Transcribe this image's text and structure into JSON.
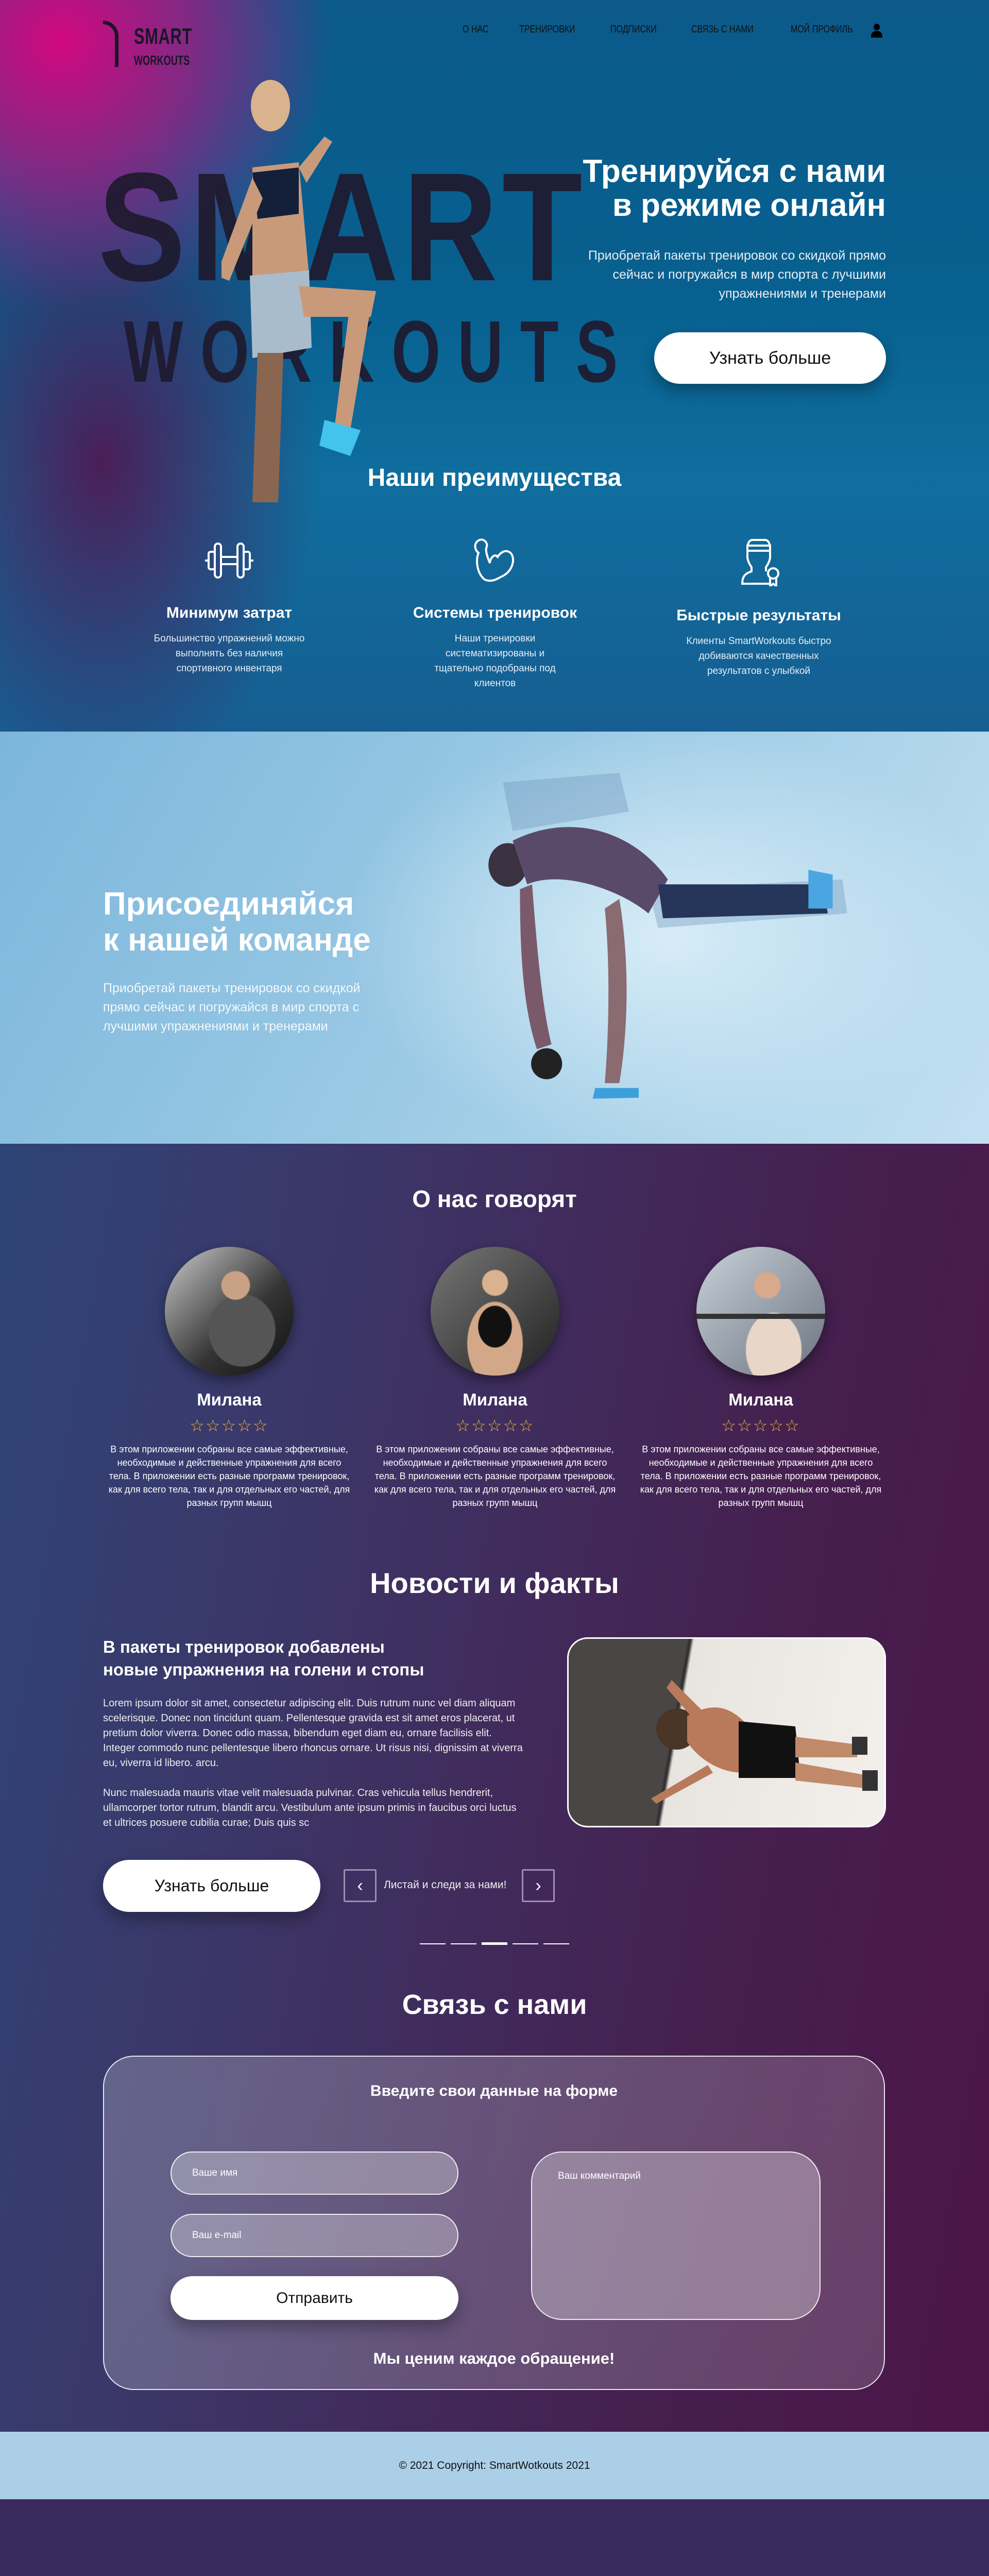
{
  "header": {
    "logo_line1": "SMART",
    "logo_line2": "WORKOUTS",
    "nav": [
      "О НАС",
      "ТРЕНИРОВКИ",
      "ПОДПИСКИ",
      "СВЯЗЬ С НАМИ",
      "МОЙ ПРОФИЛЬ"
    ],
    "profile_icon": "user-icon"
  },
  "hero": {
    "bg_word_1": "SMART",
    "bg_word_2": "WORKOUTS",
    "title_line1": "Тренируйся с нами",
    "title_line2": "в режиме онлайн",
    "subtitle": "Приобретай пакеты тренировок со скидкой прямо сейчас и погружайся в мир спорта с лучшими упражнениями и тренерами",
    "cta": "Узнать больше"
  },
  "advantages": {
    "title": "Наши преимущества",
    "items": [
      {
        "icon": "dumbbell-icon",
        "title": "Минимум затрат",
        "text": "Большинство упражнений можно выполнять без наличия спортивного инвентаря"
      },
      {
        "icon": "biceps-icon",
        "title": "Системы тренировок",
        "text": "Наши тренировки систематизированы и тщательно подобраны под клиентов"
      },
      {
        "icon": "athlete-award-icon",
        "title": "Быстрые результаты",
        "text": "Клиенты SmartWorkouts быстро добиваются качественных результатов с улыбкой"
      }
    ]
  },
  "join": {
    "title_line1": "Присоединяйся",
    "title_line2": "к нашей команде",
    "subtitle": "Приобретай пакеты тренировок со скидкой прямо сейчас и погружайся в мир спорта с лучшими упражнениями и тренерами"
  },
  "reviews": {
    "title": "О нас говорят",
    "items": [
      {
        "name": "Милана",
        "rating": 5,
        "stars": "☆☆☆☆☆",
        "text": "В этом приложении собраны все самые эффективные, необходимые и действенные упражнения для всего тела. В приложении есть разные программ тренировок, как для всего тела, так и для отдельных его частей, для разных групп мышц"
      },
      {
        "name": "Милана",
        "rating": 5,
        "stars": "☆☆☆☆☆",
        "text": "В этом приложении собраны все самые эффективные, необходимые и действенные упражнения для всего тела. В приложении есть разные программ тренировок, как для всего тела, так и для отдельных его частей, для разных групп мышц"
      },
      {
        "name": "Милана",
        "rating": 5,
        "stars": "☆☆☆☆☆",
        "text": "В этом приложении собраны все самые эффективные, необходимые и действенные упражнения для всего тела. В приложении есть разные программ тренировок, как для всего тела, так и для отдельных его частей, для разных групп мышц"
      }
    ]
  },
  "news": {
    "title": "Новости и факты",
    "headline_line1": "В пакеты тренировок добавлены",
    "headline_line2": "новые упражнения на голени и стопы",
    "paragraph1": "Lorem ipsum dolor sit amet, consectetur adipiscing elit. Duis rutrum nunc vel diam aliquam scelerisque. Donec non tincidunt quam. Pellentesque gravida est sit amet eros placerat, ut pretium dolor viverra. Donec odio massa, bibendum eget diam eu, ornare facilisis elit. Integer commodo nunc pellentesque libero rhoncus ornare. Ut risus nisi, dignissim at viverra eu, viverra id libero. arcu.",
    "paragraph2": "Nunc malesuada mauris vitae velit malesuada pulvinar. Cras vehicula tellus hendrerit, ullamcorper tortor rutrum, blandit arcu. Vestibulum ante ipsum primis in faucibus orci luctus et ultrices posuere cubilia curae; Duis quis sc",
    "cta": "Узнать больше",
    "prev": "‹",
    "next": "›",
    "slider_hint": "Листай и следи за нами!",
    "slide_count": 5,
    "active_slide": 3
  },
  "contact": {
    "title": "Связь с нами",
    "form_title": "Введите свои данные на форме",
    "name_placeholder": "Ваше имя",
    "email_placeholder": "Ваш e-mail",
    "comment_placeholder": "Ваш комментарий",
    "submit": "Отправить",
    "footer_note": "Мы ценим каждое обращение!"
  },
  "footer": {
    "copyright": "© 2021 Copyright: SmartWotkouts 2021"
  }
}
